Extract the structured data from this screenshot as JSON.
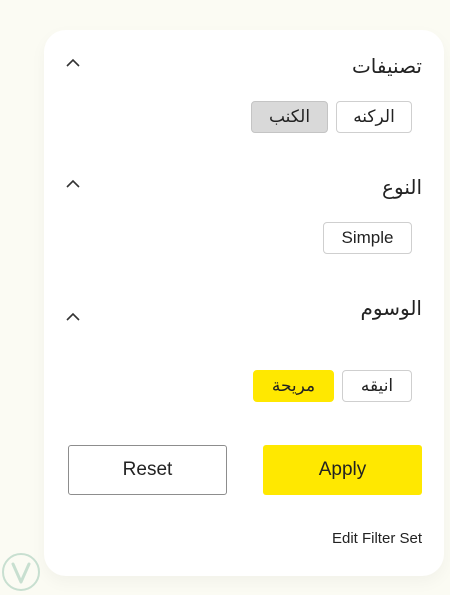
{
  "filters": {
    "categories": {
      "title": "تصنيفات",
      "chips": [
        "الركنه",
        "الكنب"
      ],
      "selected": "الكنب"
    },
    "type": {
      "title": "النوع",
      "chips": [
        "Simple"
      ]
    },
    "tags": {
      "title": "الوسوم",
      "chips": [
        "انيقه",
        "مريحة"
      ],
      "selected": "مريحة"
    }
  },
  "actions": {
    "reset_label": "Reset",
    "apply_label": "Apply",
    "edit_label": "Edit Filter Set"
  },
  "icons": {
    "collapse": "chevron-up-icon",
    "watermark": "shield-logo-icon"
  },
  "colors": {
    "accent_yellow": "#ffe800",
    "selected_gray": "#d9d9d9"
  }
}
